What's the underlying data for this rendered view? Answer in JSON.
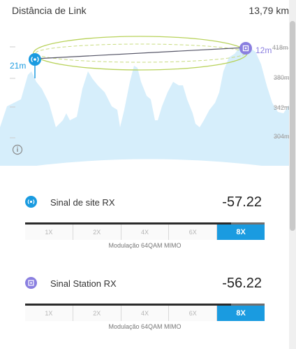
{
  "header": {
    "title": "Distância de Link",
    "distance": "13,79 km"
  },
  "profile": {
    "left_height": "21m",
    "right_height": "12m",
    "elevation_ticks": [
      "418m",
      "380m",
      "342m",
      "304m"
    ],
    "info_icon": "info-icon",
    "site_icon": "tower-icon",
    "station_icon": "station-icon",
    "colors": {
      "terrain": "#d6eefb",
      "fresnel": "#b8d25a",
      "link_line": "#555566",
      "site": "#1a9be0",
      "station": "#8a7fe0"
    }
  },
  "signals": [
    {
      "label": "Sinal de site RX",
      "value": "-57.22",
      "icon": "tower-icon",
      "color": "#1a9be0",
      "modulation_options": [
        "1X",
        "2X",
        "4X",
        "6X",
        "8X"
      ],
      "selected": "8X",
      "bar_fraction": 0.86,
      "caption": "Modulação 64QAM MIMO"
    },
    {
      "label": "Sinal Station RX",
      "value": "-56.22",
      "icon": "station-icon",
      "color": "#8a7fe0",
      "modulation_options": [
        "1X",
        "2X",
        "4X",
        "6X",
        "8X"
      ],
      "selected": "8X",
      "bar_fraction": 0.86,
      "caption": "Modulação 64QAM MIMO"
    }
  ]
}
